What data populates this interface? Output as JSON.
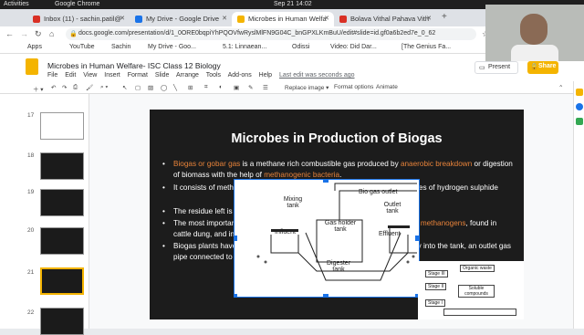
{
  "os": {
    "activities": "Activities",
    "app": "Google Chrome",
    "clock": "Sep 21  14:02"
  },
  "tabs": [
    {
      "label": "Inbox (11) - sachin.patil@",
      "color": "#d93025"
    },
    {
      "label": "My Drive - Google Drive",
      "color": "#1a73e8"
    },
    {
      "label": "Microbes in Human Welfa",
      "color": "#f4b400"
    },
    {
      "label": "Bolava Vithal Pahava Vith",
      "color": "#d93025"
    }
  ],
  "address": {
    "url": "docs.google.com/presentation/d/1_0ORE0bqpiYhPQOVfwRyslMlFN9G04C_bnGPXLKmBuU/edit#slide=id.gf0a6b2ed7e_0_62"
  },
  "bookmarks": [
    "Apps",
    "YouTube",
    "Sachin",
    "My Drive - Goo...",
    "5.1: Linnaean...",
    "Odissi",
    "Video: Did Dar...",
    "[The Genius Fa..."
  ],
  "doc": {
    "title": "Microbes in Human Welfare- ISC Class 12 Biology",
    "menu": [
      "File",
      "Edit",
      "View",
      "Insert",
      "Format",
      "Slide",
      "Arrange",
      "Tools",
      "Add-ons",
      "Help"
    ],
    "last_edit": "Last edit was seconds ago",
    "present": "Present",
    "share": "Share"
  },
  "toolbar": {
    "replace_image": "Replace image ▾",
    "format_options": "Format options",
    "animate": "Animate"
  },
  "filmstrip": [
    {
      "num": "17"
    },
    {
      "num": "18"
    },
    {
      "num": "19"
    },
    {
      "num": "20"
    },
    {
      "num": "21"
    },
    {
      "num": "22"
    }
  ],
  "slide": {
    "title": "Microbes in Production of Biogas",
    "b1_a": "Biogas or gobar gas",
    "b1_b": " is a methane rich combustible gas produced by ",
    "b1_c": "anaerobic breakdown",
    "b1_d": " or digestion of biomass with the help of ",
    "b1_e": "methanogenic bacteria",
    "b1_f": ".",
    "b2": "It consists of methane (50-70%), CO₂ (30-40%), hydrogen (2-7%) and traces of hydrogen sulphide",
    "b3": "The residue left is used as manure",
    "b4_a": "The most important methanogens are the anaerobic archaebacteria called ",
    "b4_b": "methanogens",
    "b4_c": ", found in cattle dung, and in rumen of cattle.",
    "b5": "Biogas plants have a tank, with an inlet into a large pit for passage of slurry into the tank, an outlet gas pipe connected to a stove, and a pit for removal of spent slurry"
  },
  "diagram": {
    "gas_outlet": "Bio gas outlet",
    "mixing_tank": "Mixing tank",
    "outlet_tank": "Outlet tank",
    "influent": "Influent",
    "effluent": "Effluent",
    "gas_holder": "Gas holder tank",
    "digester": "Digester tank"
  },
  "diagram2": {
    "organic": "Organic waste",
    "stage1": "Stage I",
    "stage2": "Stage II",
    "stage3": "Stage III",
    "soluble": "Soluble compounds"
  }
}
